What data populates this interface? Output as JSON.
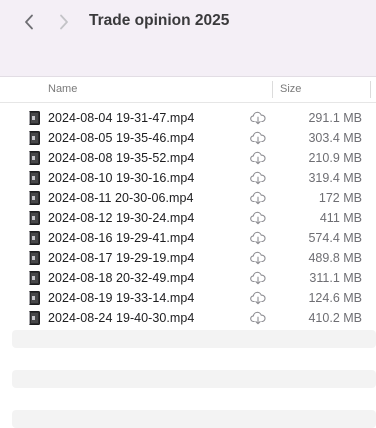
{
  "window": {
    "title": "Trade opinion 2025"
  },
  "columns": {
    "name": "Name",
    "size": "Size"
  },
  "icons": {
    "back": "chevron-left-icon",
    "forward": "chevron-right-icon",
    "file": "video-file-icon",
    "download": "icloud-download-icon"
  },
  "files": [
    {
      "name": "2024-08-04 19-31-47.mp4",
      "size": "291.1 MB"
    },
    {
      "name": "2024-08-05 19-35-46.mp4",
      "size": "303.4 MB"
    },
    {
      "name": "2024-08-08 19-35-52.mp4",
      "size": "210.9 MB"
    },
    {
      "name": "2024-08-10 19-30-16.mp4",
      "size": "319.4 MB"
    },
    {
      "name": "2024-08-11 20-30-06.mp4",
      "size": "172 MB"
    },
    {
      "name": "2024-08-12 19-30-24.mp4",
      "size": "411 MB"
    },
    {
      "name": "2024-08-16 19-29-41.mp4",
      "size": "574.4 MB"
    },
    {
      "name": "2024-08-17 19-29-19.mp4",
      "size": "489.8 MB"
    },
    {
      "name": "2024-08-18 20-32-49.mp4",
      "size": "311.1 MB"
    },
    {
      "name": "2024-08-19 19-33-14.mp4",
      "size": "124.6 MB"
    },
    {
      "name": "2024-08-24 19-40-30.mp4",
      "size": "410.2 MB"
    }
  ]
}
